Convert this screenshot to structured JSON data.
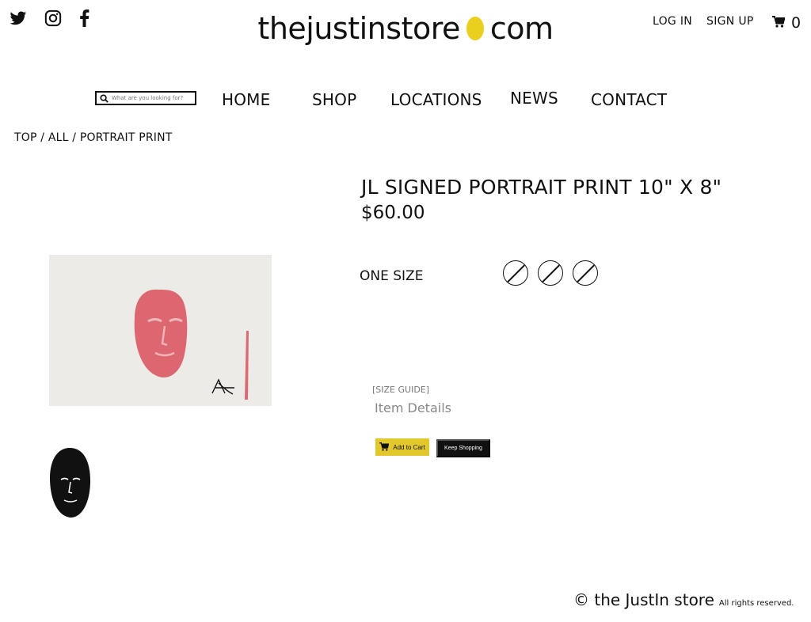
{
  "header": {
    "social": [
      "twitter-icon",
      "instagram-icon",
      "facebook-icon"
    ],
    "logo_left": "thejustinstore",
    "logo_right": "com",
    "log_in": "LOG IN",
    "sign_up": "SIGN UP",
    "cart_count": "0"
  },
  "nav": {
    "search_placeholder": "What are you looking for?",
    "items": [
      "HOME",
      "SHOP",
      "LOCATIONS",
      "NEWS",
      "CONTACT"
    ]
  },
  "breadcrumb": "TOP / ALL / PORTRAIT PRINT",
  "product": {
    "title": "JL SIGNED PORTRAIT PRINT 10\" X 8\"",
    "price": "$60.00",
    "size_label": "ONE SIZE",
    "size_options": 3,
    "size_guide": "[SIZE GUIDE]",
    "item_details": "Item Details",
    "add_to_cart": "Add to Cart",
    "keep_shopping": "Keep Shopping"
  },
  "footer": {
    "copyright": "© the JustIn store",
    "rights": "All rights reserved."
  },
  "colors": {
    "accent_yellow": "#e2c72d",
    "portrait_red": "#d9545e",
    "text": "#111111"
  }
}
